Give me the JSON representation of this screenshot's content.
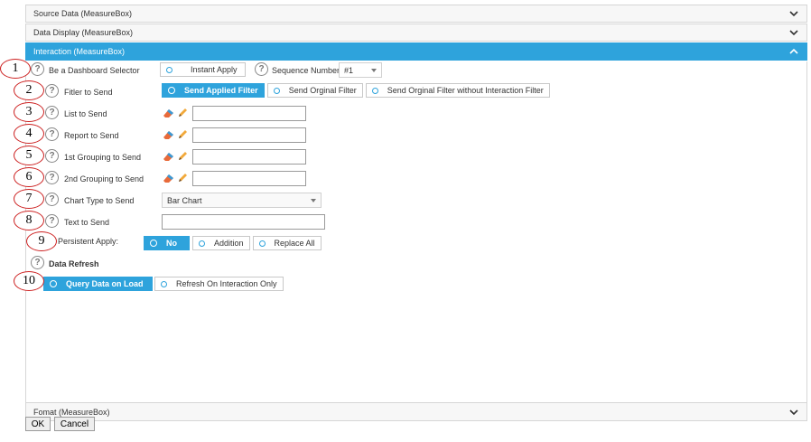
{
  "accordion": {
    "source_data": "Source Data (MeasureBox)",
    "data_display": "Data Display (MeasureBox)",
    "interaction": "Interaction (MeasureBox)",
    "format": "Fomat (MeasureBox)"
  },
  "help_glyph": "?",
  "rows": {
    "r1": {
      "num": "1",
      "label": "Be a Dashboard Selector",
      "instant_apply": "Instant Apply",
      "seq_label": "Sequence Number",
      "seq_value": "#1"
    },
    "r2": {
      "num": "2",
      "label": "Fitler to Send",
      "opt_a": "Send Applied Filter",
      "opt_b": "Send Orginal Filter",
      "opt_c": "Send Orginal Filter without Interaction Filter"
    },
    "r3": {
      "num": "3",
      "label": "List to Send"
    },
    "r4": {
      "num": "4",
      "label": "Report to Send"
    },
    "r5": {
      "num": "5",
      "label": "1st Grouping to Send"
    },
    "r6": {
      "num": "6",
      "label": "2nd Grouping to Send"
    },
    "r7": {
      "num": "7",
      "label": "Chart Type to Send",
      "value": "Bar Chart"
    },
    "r8": {
      "num": "8",
      "label": "Text to Send"
    },
    "r9": {
      "num": "9",
      "label": "Persistent Apply:",
      "opt_a": "No",
      "opt_b": "Addition",
      "opt_c": "Replace All"
    },
    "data_refresh": {
      "label": "Data Refresh"
    },
    "r10": {
      "num": "10",
      "opt_a": "Query Data on Load",
      "opt_b": "Refresh On Interaction Only"
    }
  },
  "footer": {
    "ok": "OK",
    "cancel": "Cancel"
  },
  "icons": {
    "eraser": "eraser-icon",
    "pencil": "pencil-icon",
    "help": "help-icon",
    "chevron": "chevron-down-icon"
  },
  "colors": {
    "accent": "#2ea3dc",
    "annotation": "#cc1f1f"
  }
}
